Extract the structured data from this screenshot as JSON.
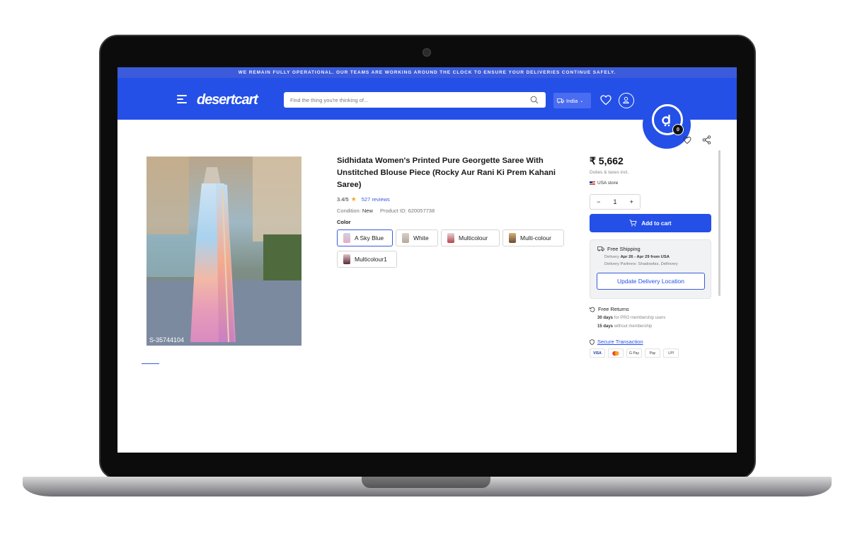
{
  "announcement": "WE REMAIN FULLY OPERATIONAL. OUR TEAMS ARE WORKING AROUND THE CLOCK TO ENSURE YOUR DELIVERIES CONTINUE SAFELY.",
  "header": {
    "logo": "desertcart",
    "search_placeholder": "Find the thing you're thinking of...",
    "country": "India",
    "cart_count": "0"
  },
  "product": {
    "title": "Sidhidata Women's Printed Pure Georgette Saree With Unstitched Blouse Piece (Rocky Aur Rani Ki Prem Kahani Saree)",
    "rating": "3.4/5",
    "reviews": "527 reviews",
    "condition_label": "Condition:",
    "condition_value": "New",
    "product_id_label": "Product ID:",
    "product_id_value": "620057738",
    "color_label": "Color",
    "colors": [
      "A Sky Blue",
      "White",
      "Multicolour",
      "Multi-colour",
      "Multicolour1"
    ],
    "image_caption": "S-35744104"
  },
  "buybox": {
    "price": "₹ 5,662",
    "duties": "Duties & taxes incl.",
    "store": "USA store",
    "quantity": "1",
    "add_to_cart": "Add to cart",
    "shipping_title": "Free Shipping",
    "delivery_label": "Delivery",
    "delivery_value": "Apr 26 - Apr 29 from USA",
    "partners": "Delivery Partners: Shadowfax, Delhivery",
    "update_location": "Update Delivery Location",
    "returns_title": "Free Returns",
    "returns_pro_days": "30 days",
    "returns_pro_text": "for PRO membership users",
    "returns_std_days": "15 days",
    "returns_std_text": "without membership",
    "secure": "Secure Transaction",
    "payments": [
      "VISA",
      "MC",
      "G Pay",
      "Pay",
      "UPI"
    ]
  },
  "colors": {
    "brand": "#2450e8",
    "announce": "#3b5bdb"
  }
}
